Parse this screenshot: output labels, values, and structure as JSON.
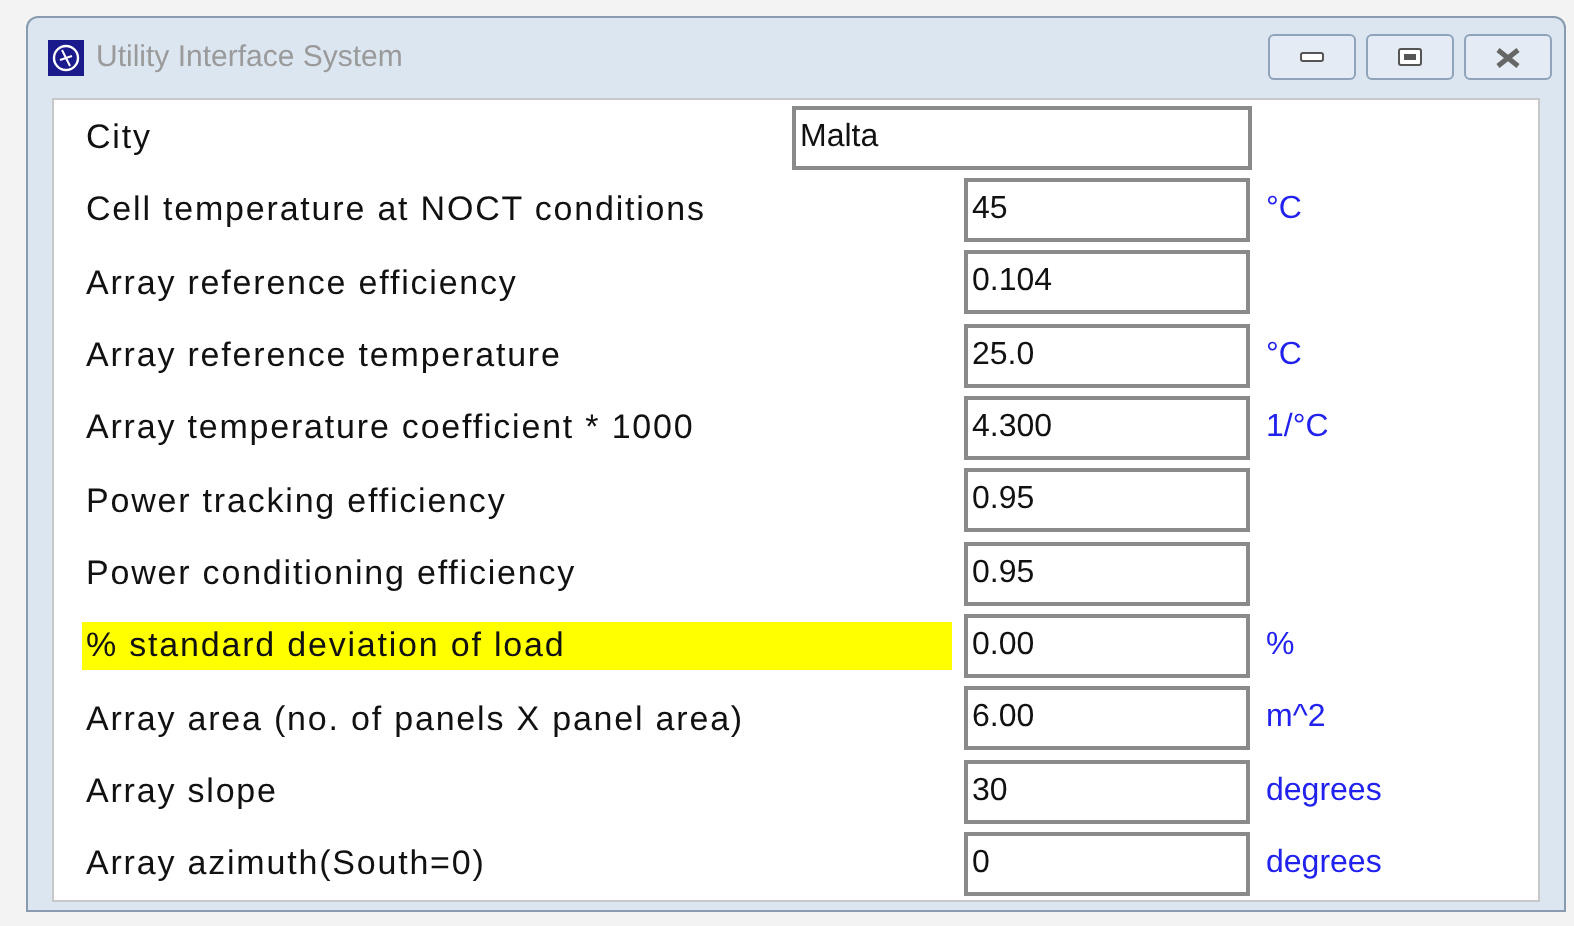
{
  "window": {
    "title": "Utility Interface System"
  },
  "fields": [
    {
      "kind": "wide",
      "label": "City",
      "value": "Malta",
      "highlighted": false
    },
    {
      "kind": "narrow",
      "label": "Cell temperature at NOCT conditions",
      "value": "45",
      "unit": "°C",
      "highlighted": false
    },
    {
      "kind": "narrow",
      "label": "Array reference efficiency",
      "value": "0.104",
      "highlighted": false
    },
    {
      "kind": "narrow",
      "label": "Array reference temperature",
      "value": "25.0",
      "unit": "°C",
      "highlighted": false
    },
    {
      "kind": "narrow",
      "label": "Array temperature coefficient * 1000",
      "value": "4.300",
      "unit": "1/°C",
      "highlighted": false
    },
    {
      "kind": "narrow",
      "label": "Power tracking efficiency",
      "value": "0.95",
      "highlighted": false
    },
    {
      "kind": "narrow",
      "label": "Power conditioning efficiency",
      "value": "0.95",
      "highlighted": false
    },
    {
      "kind": "narrow",
      "label": "% standard deviation of load",
      "value": "0.00",
      "unit": "%",
      "highlighted": true
    },
    {
      "kind": "narrow",
      "label": "Array area (no. of panels X panel area)",
      "value": "6.00",
      "unit": "m^2",
      "highlighted": false
    },
    {
      "kind": "narrow",
      "label": "Array slope",
      "value": "30",
      "unit": "degrees",
      "highlighted": false
    },
    {
      "kind": "narrow",
      "label": "Array azimuth(South=0)",
      "value": "0",
      "unit": "degrees",
      "highlighted": false
    }
  ]
}
